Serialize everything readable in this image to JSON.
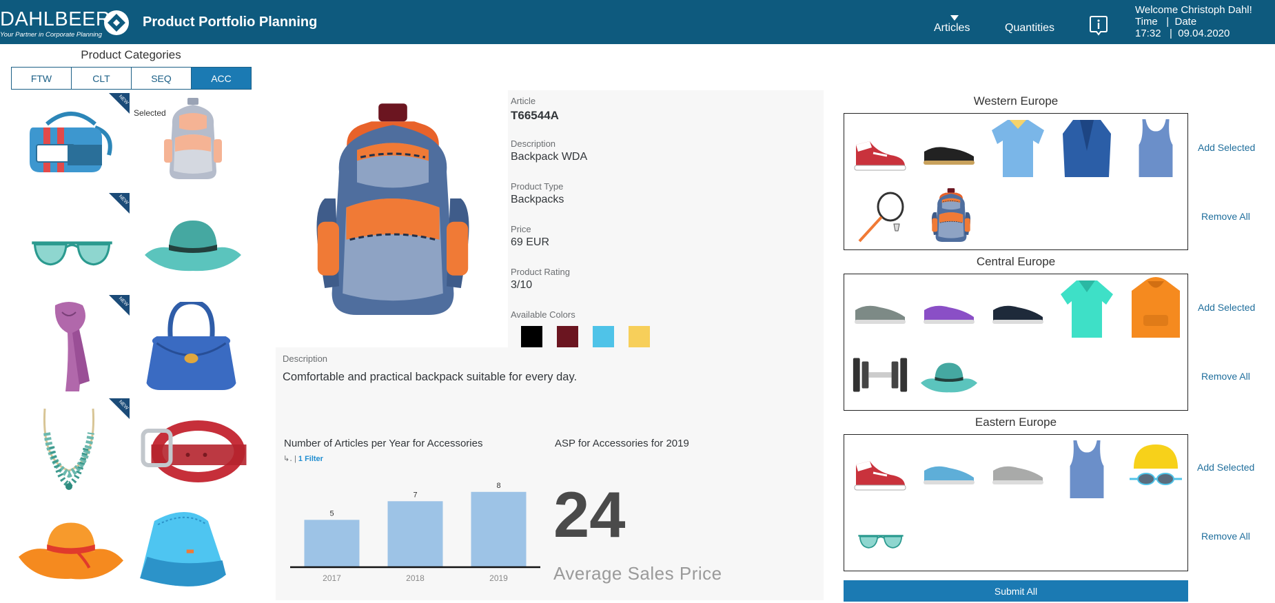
{
  "header": {
    "logo_text": "DAHLBEER",
    "logo_tagline": "Your Partner in Corporate Planning",
    "app_title": "Product Portfolio Planning",
    "nav_articles": "Articles",
    "nav_quantities": "Quantities",
    "info_icon": "info-icon",
    "welcome": "Welcome Christoph Dahl!",
    "time_date_label": "Time   |  Date",
    "time_date_value": "17:32   |  09.04.2020"
  },
  "categories": {
    "title": "Product Categories",
    "tabs": [
      "FTW",
      "CLT",
      "SEQ",
      "ACC"
    ],
    "active_tab": "ACC",
    "selected_label": "Selected",
    "new_badge": "NEW",
    "products": [
      {
        "name": "duffel-bag",
        "new": true
      },
      {
        "name": "backpack",
        "new": false,
        "selected": true
      },
      {
        "name": "sunglasses",
        "new": true
      },
      {
        "name": "sun-hat-teal",
        "new": false
      },
      {
        "name": "scarf",
        "new": true
      },
      {
        "name": "handbag",
        "new": false
      },
      {
        "name": "necklace",
        "new": true
      },
      {
        "name": "belt",
        "new": false
      },
      {
        "name": "sun-hat-orange",
        "new": false
      },
      {
        "name": "bucket-hat",
        "new": false
      }
    ]
  },
  "article": {
    "article_label": "Article",
    "article_id": "T66544A",
    "description_label": "Description",
    "description": "Backpack WDA",
    "product_type_label": "Product Type",
    "product_type": "Backpacks",
    "price_label": "Price",
    "price": "69 EUR",
    "rating_label": "Product Rating",
    "rating": "3/10",
    "colors_label": "Available Colors",
    "colors": [
      "#000000",
      "#6b1520",
      "#4fc3e8",
      "#f7cf5a"
    ]
  },
  "long_description": {
    "label": "Description",
    "text": "Comfortable and practical backpack suitable for every day."
  },
  "bar_chart": {
    "title": "Number of Articles per Year for Accessories",
    "filter_text": "1 Filter"
  },
  "chart_data": {
    "type": "bar",
    "title": "Number of Articles per Year for Accessories",
    "categories": [
      "2017",
      "2018",
      "2019"
    ],
    "values": [
      5,
      7,
      8
    ],
    "xlabel": "",
    "ylabel": "",
    "ylim": [
      0,
      8.5
    ],
    "color": "#9dc3e6"
  },
  "kpi": {
    "title": "ASP for Accessories for 2019",
    "value": "24",
    "caption": "Average Sales Price"
  },
  "regions": [
    {
      "title": "Western Europe",
      "items": [
        "red-sneaker",
        "black-shoe",
        "polo-shirt",
        "blazer",
        "tank-top",
        "badminton-racket",
        "backpack"
      ]
    },
    {
      "title": "Central Europe",
      "items": [
        "grey-running-shoe",
        "purple-running-shoe",
        "black-running-shoe",
        "teal-shirt",
        "orange-hoodie",
        "dumbbell",
        "sun-hat-teal"
      ]
    },
    {
      "title": "Eastern Europe",
      "items": [
        "red-sneaker",
        "blue-running-shoe",
        "grey-shoe",
        "tank-top",
        "swim-cap-goggles",
        "sunglasses"
      ]
    }
  ],
  "region_actions": {
    "add": "Add Selected",
    "remove": "Remove All"
  },
  "submit_label": "Submit All"
}
